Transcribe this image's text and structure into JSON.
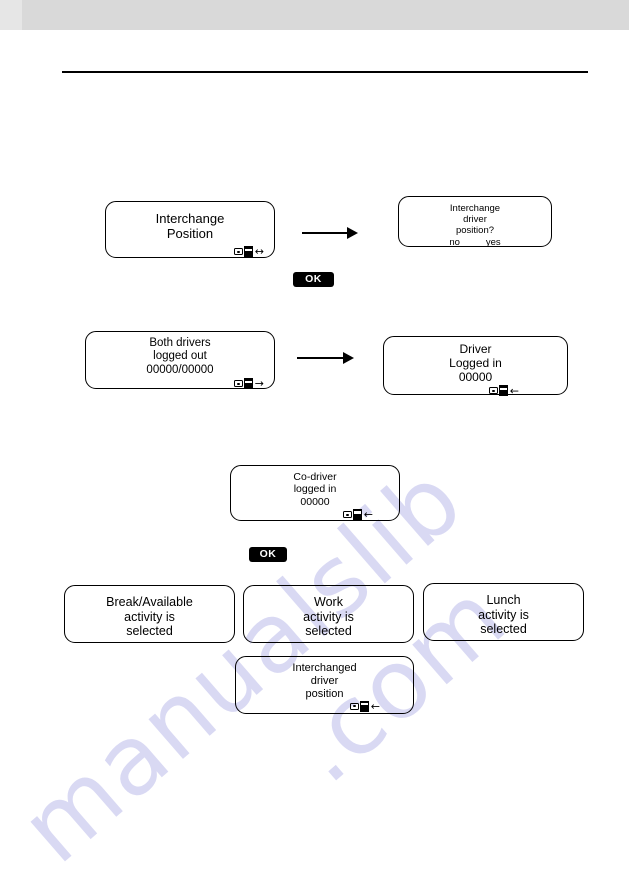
{
  "page": {
    "background_color": "#ffffff",
    "band_color": "#d9d9d9",
    "rule_color": "#000000",
    "watermark_color": "#cdcdf0",
    "watermark_text_1": "manualslib",
    "watermark_text_2": ".com"
  },
  "displays": {
    "interchange_position": {
      "name": "interchange-position",
      "lines": [
        "Interchange",
        "Position"
      ],
      "icon": "card-slot-both-arrows",
      "icon_arrow": "↔"
    },
    "interchange_driver_position_q": {
      "name": "interchange-driver-position-question",
      "lines": [
        "Interchange",
        "driver",
        "position?"
      ],
      "softkey_no": "no",
      "softkey_yes": "yes"
    },
    "both_drivers_logged_out": {
      "name": "both-drivers-logged-out",
      "lines": [
        "Both drivers",
        "logged out",
        "00000/00000"
      ],
      "icon": "card-slot-right-arrow",
      "icon_arrow": "→"
    },
    "driver_logged_in": {
      "name": "driver-logged-in",
      "lines": [
        "Driver",
        "Logged in",
        "00000"
      ],
      "icon": "card-slot-left-arrow",
      "icon_arrow": "←"
    },
    "codriver_logged_in": {
      "name": "codriver-logged-in",
      "lines": [
        "Co-driver",
        "logged in",
        "00000"
      ],
      "icon": "card-slot-left-arrow",
      "icon_arrow": "←"
    },
    "break_available": {
      "name": "break-available-selected",
      "lines": [
        "Break/Available",
        "activity is",
        "selected"
      ]
    },
    "work_selected": {
      "name": "work-selected",
      "lines": [
        "Work",
        "activity is",
        "selected"
      ]
    },
    "lunch_selected": {
      "name": "lunch-selected",
      "lines": [
        "Lunch",
        "activity is",
        "selected"
      ]
    },
    "interchanged_driver_position": {
      "name": "interchanged-driver-position",
      "lines": [
        "Interchanged",
        "driver",
        "position"
      ],
      "icon": "card-slot-left-arrow",
      "icon_arrow": "←"
    }
  },
  "keys": {
    "ok_top": "OK",
    "ok_middle": "OK"
  }
}
